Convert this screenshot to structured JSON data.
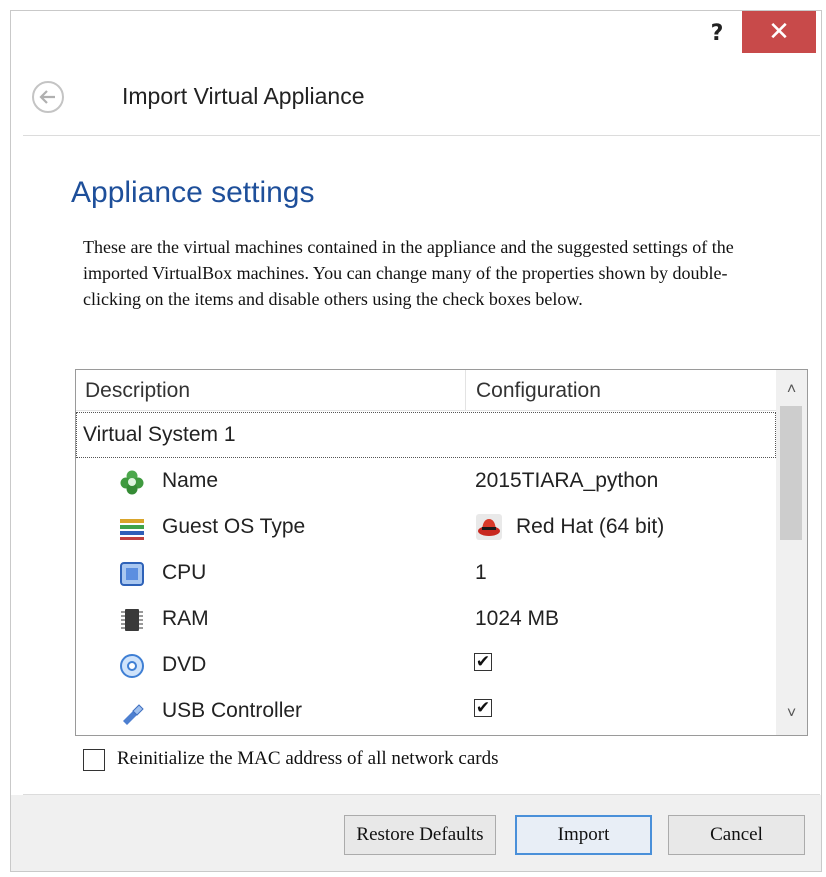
{
  "window": {
    "help_label": "?",
    "close_label": "✕"
  },
  "wizard": {
    "title": "Import Virtual Appliance",
    "back_icon": "back-arrow-icon"
  },
  "section": {
    "title": "Appliance settings",
    "description": "These are the virtual machines contained in the appliance and the suggested settings of the imported VirtualBox machines. You can change many of the properties shown by double-clicking on the items and disable others using the check boxes below."
  },
  "table": {
    "columns": [
      "Description",
      "Configuration"
    ],
    "group": "Virtual System 1",
    "rows": [
      {
        "icon": "name-icon",
        "label": "Name",
        "value": "2015TIARA_python"
      },
      {
        "icon": "guest-os-icon",
        "label": "Guest OS Type",
        "value": "Red Hat (64 bit)",
        "value_icon": "redhat-icon"
      },
      {
        "icon": "cpu-icon",
        "label": "CPU",
        "value": "1"
      },
      {
        "icon": "ram-icon",
        "label": "RAM",
        "value": "1024 MB"
      },
      {
        "icon": "dvd-icon",
        "label": "DVD",
        "checked": true,
        "check_mark": "✔"
      },
      {
        "icon": "usb-icon",
        "label": "USB Controller",
        "checked": true,
        "check_mark": "✔"
      }
    ]
  },
  "mac_option": {
    "label": "Reinitialize the MAC address of all network cards",
    "checked": false
  },
  "buttons": {
    "restore": "Restore Defaults",
    "import": "Import",
    "cancel": "Cancel"
  },
  "colors": {
    "accent": "#1e4f9a",
    "close": "#c84a4a"
  }
}
